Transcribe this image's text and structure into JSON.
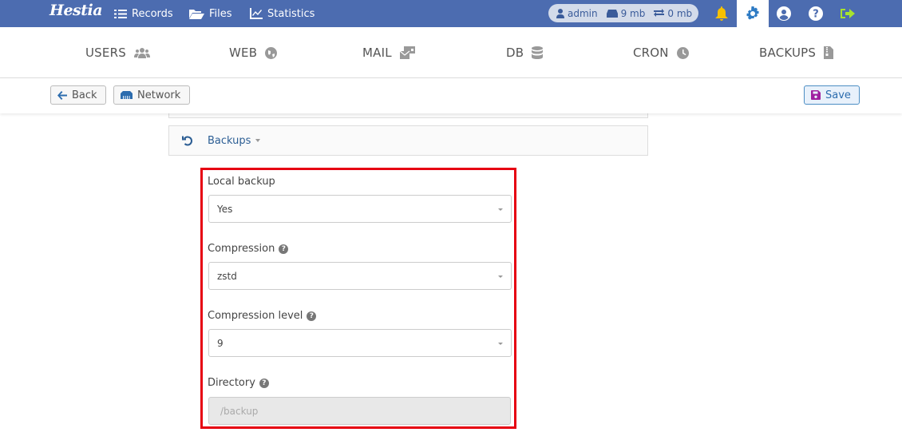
{
  "topbar": {
    "logo": "Hestia",
    "nav": [
      {
        "label": "Records",
        "icon": "list-check-icon"
      },
      {
        "label": "Files",
        "icon": "folder-open-icon"
      },
      {
        "label": "Statistics",
        "icon": "chart-line-icon"
      }
    ],
    "user": {
      "name": "admin",
      "disk": "9 mb",
      "bandwidth": "0 mb"
    },
    "icons": [
      "bell-icon",
      "gear-icon",
      "user-circle-icon",
      "question-circle-icon",
      "logout-icon"
    ]
  },
  "sections": [
    {
      "label": "USERS",
      "icon": "users-icon"
    },
    {
      "label": "WEB",
      "icon": "globe-icon"
    },
    {
      "label": "MAIL",
      "icon": "mail-bulk-icon"
    },
    {
      "label": "DB",
      "icon": "database-icon"
    },
    {
      "label": "CRON",
      "icon": "clock-icon"
    },
    {
      "label": "BACKUPS",
      "icon": "file-archive-icon"
    }
  ],
  "toolbar": {
    "back_label": "Back",
    "network_label": "Network",
    "save_label": "Save"
  },
  "panel": {
    "title": "Backups"
  },
  "form": {
    "local_backup": {
      "label": "Local backup",
      "value": "Yes"
    },
    "compression": {
      "label": "Compression",
      "value": "zstd"
    },
    "compression_level": {
      "label": "Compression level",
      "value": "9"
    },
    "directory": {
      "label": "Directory",
      "value": "/backup"
    }
  },
  "colors": {
    "topbar": "#4c6cb0",
    "highlight_border": "#e60012",
    "save_icon": "#a020a0",
    "bell": "#f6c100",
    "logout": "#a6e22e"
  }
}
